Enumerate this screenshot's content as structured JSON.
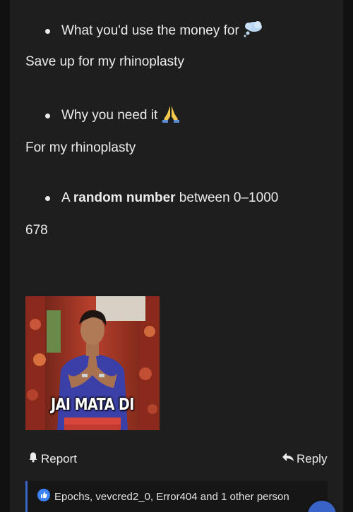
{
  "post": {
    "items": [
      {
        "prompt": "What you'd use the money for",
        "icon": "thought-bubble-emoji",
        "answer": "Save up for my rhinoplasty"
      },
      {
        "prompt": "Why you need it",
        "icon": "folded-hands-emoji",
        "answer": "For my rhinoplasty"
      },
      {
        "prompt_prefix": "A ",
        "prompt_bold": "random number",
        "prompt_suffix": " between 0–1000",
        "answer": "678"
      }
    ],
    "gif": {
      "caption": "JAI MATA DI",
      "icon": "praying-man-gif"
    }
  },
  "actions": {
    "report_label": "Report",
    "report_icon": "bell-icon",
    "reply_label": "Reply",
    "reply_icon": "reply-arrow-icon"
  },
  "reactions": {
    "icon": "thumbs-up-icon",
    "text": "Epochs, vevcred2_0, Error404 and 1 other person"
  },
  "colors": {
    "page_background": "#111111",
    "post_background": "#1e1e1e",
    "accent": "#3a63c7",
    "text": "#ececec"
  }
}
